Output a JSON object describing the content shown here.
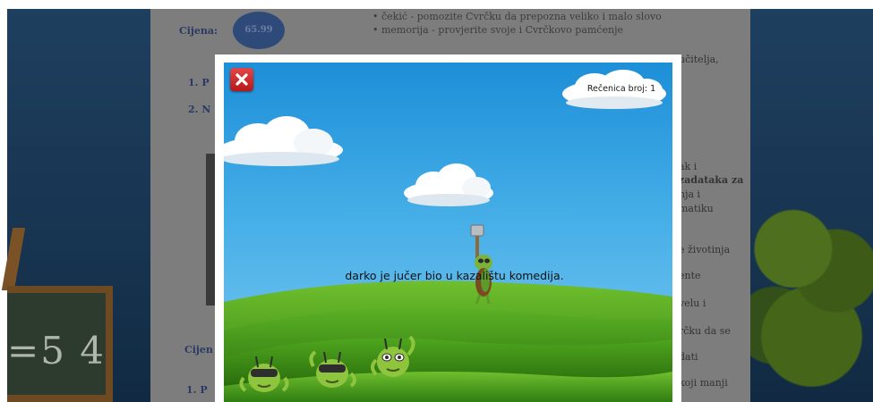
{
  "background_page": {
    "cijena_label": "Cijena:",
    "price": "65.99",
    "bullets": [
      "• čekić - pomozite Cvrčku da prepozna veliko i malo slovo",
      "• memorija - provjerite svoje i Cvrčkovo pamćenje"
    ],
    "numbered": [
      "1. P",
      "2. N"
    ],
    "cijena_label_2": "Cijen",
    "numbered_bottom": "1. P",
    "right_fragments": [
      "učitelja,",
      "ak i",
      "zadataka za",
      "nja i",
      "matiku",
      "e životinja",
      "ente",
      "velu i",
      "rčku da se",
      "dati",
      "koji manji"
    ],
    "chalkboard_text": "=5 4"
  },
  "game": {
    "sentence": "darko je jučer bio u kazalištu komedija.",
    "badge_label": "Rečenica broj: 1",
    "close_icon": "close-x-icon",
    "colors": {
      "sky_top": "#1d8fd8",
      "sky_bottom": "#7cc9f1",
      "grass": "#3f9a1c",
      "close_button": "#c62828"
    }
  }
}
